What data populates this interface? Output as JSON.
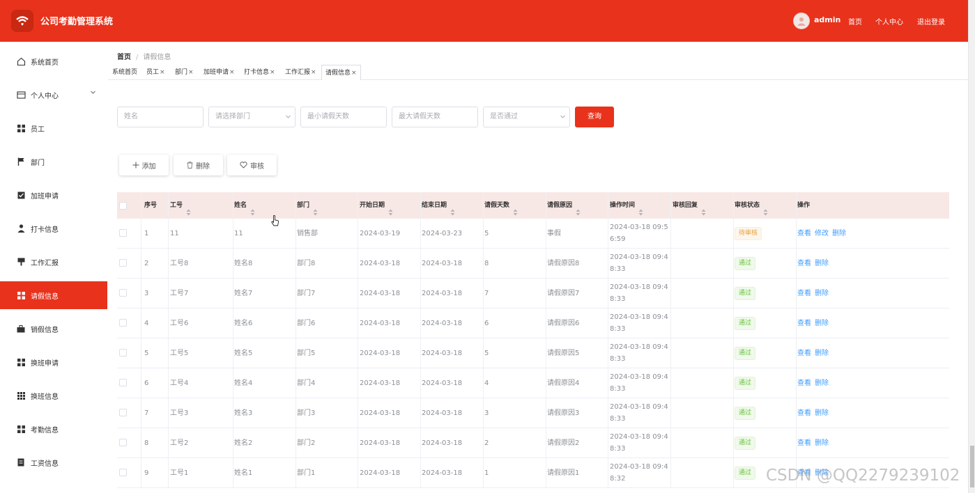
{
  "app": {
    "title": "公司考勤管理系统",
    "user": "admin"
  },
  "top_nav": [
    "首页",
    "个人中心",
    "退出登录"
  ],
  "sidebar": {
    "items": [
      {
        "label": "系统首页",
        "icon": "home-icon"
      },
      {
        "label": "个人中心",
        "icon": "user-card-icon"
      },
      {
        "label": "员工",
        "icon": "grid-icon"
      },
      {
        "label": "部门",
        "icon": "flag-icon"
      },
      {
        "label": "加班申请",
        "icon": "clipboard-check-icon"
      },
      {
        "label": "打卡信息",
        "icon": "person-icon"
      },
      {
        "label": "工作汇报",
        "icon": "board-icon"
      },
      {
        "label": "请假信息",
        "icon": "grid-icon",
        "active": true
      },
      {
        "label": "销假信息",
        "icon": "briefcase-icon"
      },
      {
        "label": "换班申请",
        "icon": "grid-icon"
      },
      {
        "label": "换班信息",
        "icon": "dots-grid-icon"
      },
      {
        "label": "考勤信息",
        "icon": "grid-icon"
      },
      {
        "label": "工资信息",
        "icon": "document-icon"
      }
    ]
  },
  "breadcrumb": {
    "home": "首页",
    "current": "请假信息"
  },
  "tabs": [
    {
      "label": "系统首页",
      "closable": false
    },
    {
      "label": "员工",
      "closable": true
    },
    {
      "label": "部门",
      "closable": true
    },
    {
      "label": "加班申请",
      "closable": true
    },
    {
      "label": "打卡信息",
      "closable": true
    },
    {
      "label": "工作汇报",
      "closable": true
    },
    {
      "label": "请假信息",
      "closable": true,
      "active": true
    }
  ],
  "tab_close": "×",
  "search": {
    "name_placeholder": "姓名",
    "dept_placeholder": "请选择部门",
    "min_days_placeholder": "最小请假天数",
    "max_days_placeholder": "最大请假天数",
    "approved_placeholder": "是否通过",
    "query_label": "查询"
  },
  "toolbar": {
    "add_label": "添加",
    "delete_label": "删除",
    "review_label": "审核"
  },
  "table": {
    "headers": [
      "序号",
      "工号",
      "姓名",
      "部门",
      "开始日期",
      "结束日期",
      "请假天数",
      "请假原因",
      "操作时间",
      "审核回复",
      "审核状态",
      "操作"
    ],
    "rows": [
      {
        "no": "1",
        "emp_id": "11",
        "name": "11",
        "dept": "销售部",
        "start": "2024-03-19",
        "end": "2024-03-23",
        "days": "5",
        "reason": "事假",
        "time1": "2024-03-18 09:5",
        "time2": "6:59",
        "reply": "",
        "status": "待审核",
        "status_type": "pending",
        "ops": [
          "查看",
          "修改",
          "删除"
        ]
      },
      {
        "no": "2",
        "emp_id": "工号8",
        "name": "姓名8",
        "dept": "部门8",
        "start": "2024-03-18",
        "end": "2024-03-18",
        "days": "8",
        "reason": "请假原因8",
        "time1": "2024-03-18 09:4",
        "time2": "8:33",
        "reply": "",
        "status": "通过",
        "status_type": "pass",
        "ops": [
          "查看",
          "删除"
        ]
      },
      {
        "no": "3",
        "emp_id": "工号7",
        "name": "姓名7",
        "dept": "部门7",
        "start": "2024-03-18",
        "end": "2024-03-18",
        "days": "7",
        "reason": "请假原因7",
        "time1": "2024-03-18 09:4",
        "time2": "8:33",
        "reply": "",
        "status": "通过",
        "status_type": "pass",
        "ops": [
          "查看",
          "删除"
        ]
      },
      {
        "no": "4",
        "emp_id": "工号6",
        "name": "姓名6",
        "dept": "部门6",
        "start": "2024-03-18",
        "end": "2024-03-18",
        "days": "6",
        "reason": "请假原因6",
        "time1": "2024-03-18 09:4",
        "time2": "8:33",
        "reply": "",
        "status": "通过",
        "status_type": "pass",
        "ops": [
          "查看",
          "删除"
        ]
      },
      {
        "no": "5",
        "emp_id": "工号5",
        "name": "姓名5",
        "dept": "部门5",
        "start": "2024-03-18",
        "end": "2024-03-18",
        "days": "5",
        "reason": "请假原因5",
        "time1": "2024-03-18 09:4",
        "time2": "8:33",
        "reply": "",
        "status": "通过",
        "status_type": "pass",
        "ops": [
          "查看",
          "删除"
        ]
      },
      {
        "no": "6",
        "emp_id": "工号4",
        "name": "姓名4",
        "dept": "部门4",
        "start": "2024-03-18",
        "end": "2024-03-18",
        "days": "4",
        "reason": "请假原因4",
        "time1": "2024-03-18 09:4",
        "time2": "8:33",
        "reply": "",
        "status": "通过",
        "status_type": "pass",
        "ops": [
          "查看",
          "删除"
        ]
      },
      {
        "no": "7",
        "emp_id": "工号3",
        "name": "姓名3",
        "dept": "部门3",
        "start": "2024-03-18",
        "end": "2024-03-18",
        "days": "3",
        "reason": "请假原因3",
        "time1": "2024-03-18 09:4",
        "time2": "8:33",
        "reply": "",
        "status": "通过",
        "status_type": "pass",
        "ops": [
          "查看",
          "删除"
        ]
      },
      {
        "no": "8",
        "emp_id": "工号2",
        "name": "姓名2",
        "dept": "部门2",
        "start": "2024-03-18",
        "end": "2024-03-18",
        "days": "2",
        "reason": "请假原因2",
        "time1": "2024-03-18 09:4",
        "time2": "8:33",
        "reply": "",
        "status": "通过",
        "status_type": "pass",
        "ops": [
          "查看",
          "删除"
        ]
      },
      {
        "no": "9",
        "emp_id": "工号1",
        "name": "姓名1",
        "dept": "部门1",
        "start": "2024-03-18",
        "end": "2024-03-18",
        "days": "1",
        "reason": "请假原因1",
        "time1": "2024-03-18 09:4",
        "time2": "8:32",
        "reply": "",
        "status": "通过",
        "status_type": "pass",
        "ops": [
          "查看",
          "删除"
        ]
      }
    ]
  },
  "watermark": "CSDN @QQ2279239102",
  "colors": {
    "primary": "#e8321c",
    "link": "#409eff",
    "header_bg": "#f8e8e5",
    "pass": "#67c23a",
    "pending": "#e6a23c"
  }
}
